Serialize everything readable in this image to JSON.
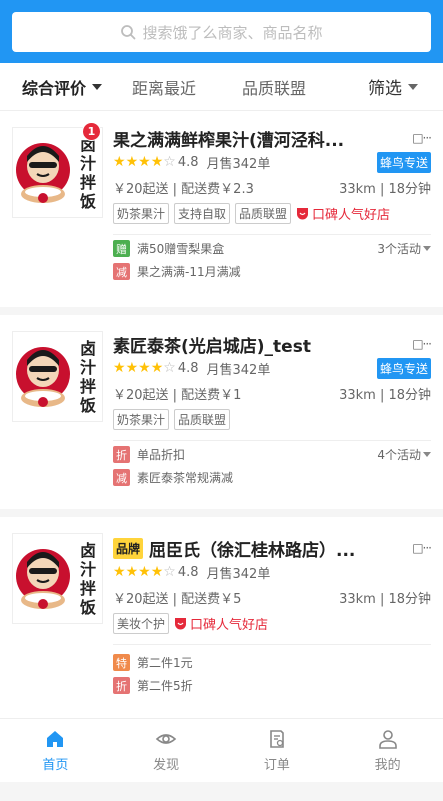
{
  "search": {
    "placeholder": "搜索饿了么商家、商品名称"
  },
  "sort": {
    "items": [
      "综合评价",
      "距离最近",
      "品质联盟"
    ],
    "filter_label": "筛选"
  },
  "stores": [
    {
      "name": "果之满满鲜榨果汁(漕河泾科...",
      "badge_count": "1",
      "brand_tag": "",
      "rating": "4.8",
      "sales": "月售342单",
      "delivery_tag": "蜂鸟专送",
      "fee": "￥20起送 | 配送费￥2.3",
      "distance": "33km | 18分钟",
      "tags": [
        "奶茶果汁",
        "支持自取",
        "品质联盟"
      ],
      "hot": "口碑人气好店",
      "activity_count": "3个活动",
      "activities": [
        {
          "icon": "赠",
          "color": "green",
          "text": "满50赠雪梨果盒"
        },
        {
          "icon": "减",
          "color": "red",
          "text": "果之满满-11月满减"
        }
      ]
    },
    {
      "name": "素匠泰茶(光启城店)_test",
      "badge_count": "",
      "brand_tag": "",
      "rating": "4.8",
      "sales": "月售342单",
      "delivery_tag": "蜂鸟专送",
      "fee": "￥20起送 | 配送费￥1",
      "distance": "33km | 18分钟",
      "tags": [
        "奶茶果汁",
        "品质联盟"
      ],
      "hot": "",
      "activity_count": "4个活动",
      "activities": [
        {
          "icon": "折",
          "color": "red",
          "text": "单品折扣"
        },
        {
          "icon": "减",
          "color": "red",
          "text": "素匠泰茶常规满减"
        }
      ]
    },
    {
      "name": "屈臣氏（徐汇桂林路店）...",
      "badge_count": "",
      "brand_tag": "品牌",
      "rating": "4.8",
      "sales": "月售342单",
      "delivery_tag": "",
      "fee": "￥20起送 | 配送费￥5",
      "distance": "33km | 18分钟",
      "tags": [
        "美妆个护"
      ],
      "hot": "口碑人气好店",
      "activity_count": "",
      "activities": [
        {
          "icon": "特",
          "color": "orange",
          "text": "第二件1元"
        },
        {
          "icon": "折",
          "color": "red",
          "text": "第二件5折"
        }
      ]
    }
  ],
  "logo_text": [
    "卤",
    "汁",
    "拌",
    "饭"
  ],
  "tabs": [
    "首页",
    "发现",
    "订单",
    "我的"
  ]
}
